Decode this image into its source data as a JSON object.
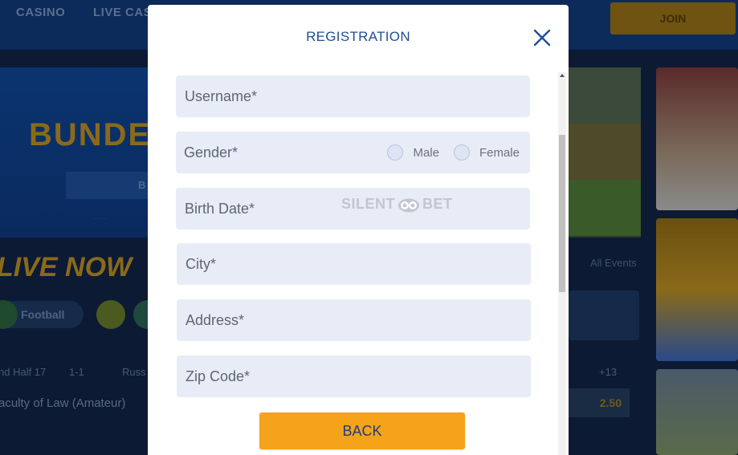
{
  "background": {
    "nav": [
      "CASINO",
      "LIVE CAS"
    ],
    "join_label": "JOIN",
    "hero_title": "BUNDE",
    "hero_button": "B",
    "live_now": "LIVE NOW",
    "sport": "Football",
    "row1": [
      "nd Half 17",
      "1-1",
      "Russ",
      "+13"
    ],
    "row2_team": "aculty of Law (Amateur)",
    "odds_value": "2.50",
    "all_events": "All Events"
  },
  "modal": {
    "title": "REGISTRATION",
    "close_icon": "close-icon",
    "fields": {
      "username": "Username*",
      "gender": "Gender*",
      "birth_date": "Birth Date*",
      "city": "City*",
      "address": "Address*",
      "zip_code": "Zip Code*"
    },
    "gender_options": [
      "Male",
      "Female"
    ],
    "watermark": [
      "SILENT",
      "BET"
    ],
    "back_label": "BACK"
  },
  "colors": {
    "accent": "#f5a31a",
    "title": "#1f4f96",
    "field_bg": "#e8ecf7"
  }
}
